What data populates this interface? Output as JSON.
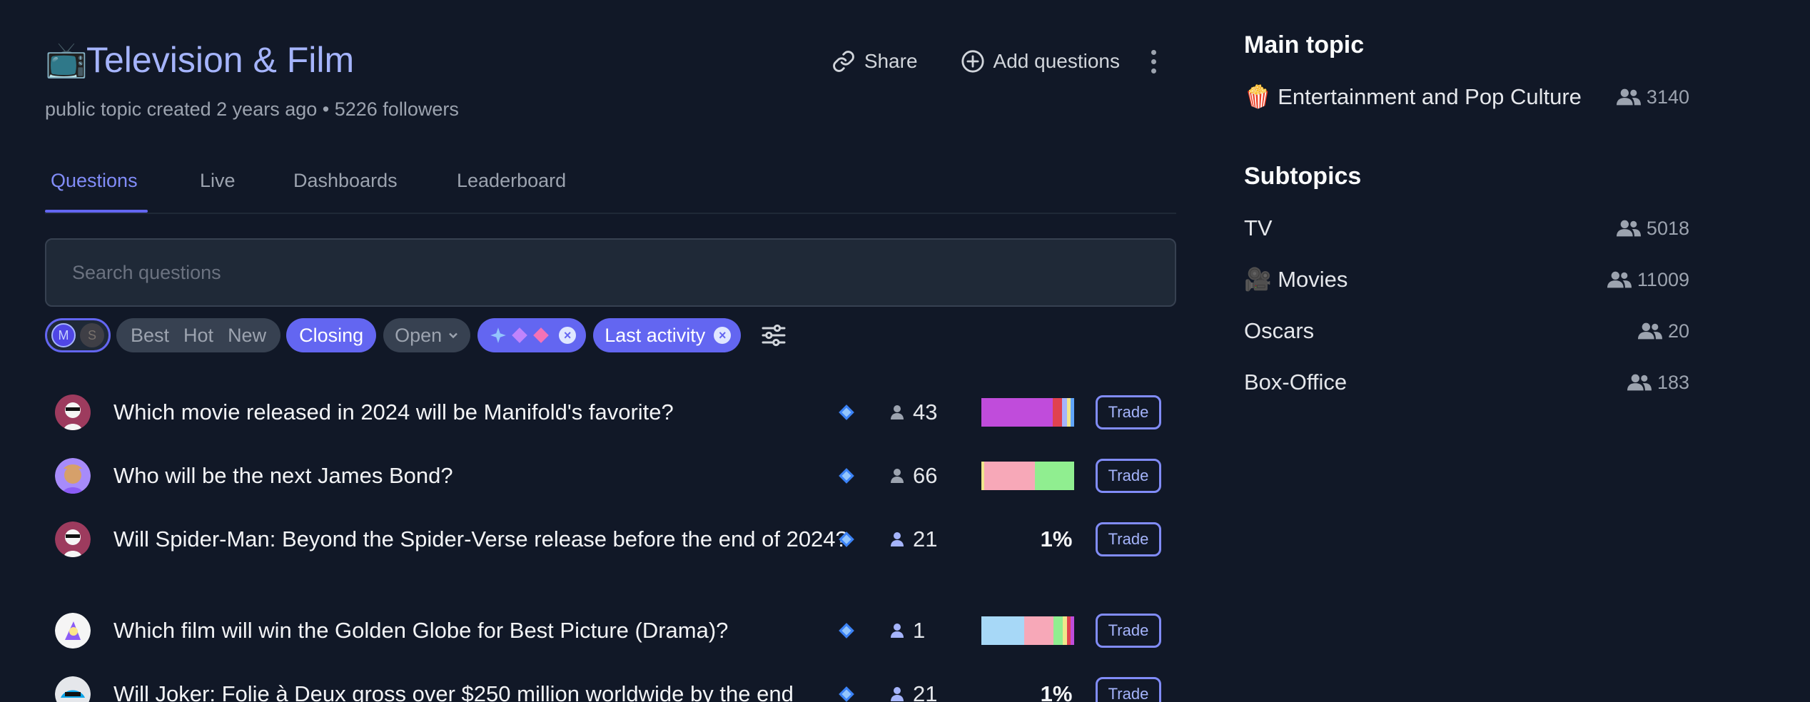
{
  "topic": {
    "emoji": "📺",
    "title": "Television & Film",
    "meta_prefix": "public topic created",
    "created": "2 years ago",
    "separator": "•",
    "followers": "5226 followers"
  },
  "header_actions": {
    "share_label": "Share",
    "add_label": "Add questions"
  },
  "tabs": [
    {
      "label": "Questions",
      "active": true
    },
    {
      "label": "Live"
    },
    {
      "label": "Dashboards"
    },
    {
      "label": "Leaderboard"
    }
  ],
  "search": {
    "placeholder": "Search questions"
  },
  "filters": {
    "sort_options": [
      "Best",
      "Hot",
      "New"
    ],
    "closing_label": "Closing",
    "status_label": "Open",
    "last_activity_label": "Last activity",
    "avatar_m_letter": "M",
    "avatar_s_letter": "S"
  },
  "questions": [
    {
      "title": "Which movie released in 2024 will be Manifold's favorite?",
      "traders": "43",
      "bar": [
        {
          "color": "#c04cdb",
          "fraction": 0.77
        },
        {
          "color": "#e0424f",
          "fraction": 0.1
        },
        {
          "color": "#a5b4fc",
          "fraction": 0.05
        },
        {
          "color": "#f0e68c",
          "fraction": 0.04
        },
        {
          "color": "#60a5fa",
          "fraction": 0.04
        }
      ],
      "trade_label": "Trade"
    },
    {
      "title": "Who will be the next James Bond?",
      "traders": "66",
      "bar": [
        {
          "color": "#f0e68c",
          "fraction": 0.03
        },
        {
          "color": "#f7a8b8",
          "fraction": 0.55
        },
        {
          "color": "#90ee90",
          "fraction": 0.42
        }
      ],
      "trade_label": "Trade"
    },
    {
      "title": "Will Spider-Man: Beyond the Spider-Verse release before the end of 2024?",
      "traders": "21",
      "probability": "1%",
      "trade_label": "Trade"
    },
    {
      "title": "Which film will win the Golden Globe for Best Picture (Drama)?",
      "traders": "1",
      "bar": [
        {
          "color": "#a7d8f7",
          "fraction": 0.46
        },
        {
          "color": "#f7a8b8",
          "fraction": 0.32
        },
        {
          "color": "#90ee90",
          "fraction": 0.1
        },
        {
          "color": "#f0e68c",
          "fraction": 0.04
        },
        {
          "color": "#e0424f",
          "fraction": 0.04
        },
        {
          "color": "#c04cdb",
          "fraction": 0.04
        }
      ],
      "trade_label": "Trade"
    },
    {
      "title": "Will Joker: Folie à Deux gross over $250 million worldwide by the end",
      "traders": "21",
      "probability": "1%",
      "trade_label": "Trade"
    }
  ],
  "sidebar": {
    "main_heading": "Main topic",
    "main_topic": {
      "emoji": "🍿",
      "name": "Entertainment and Pop Culture",
      "count": "3140"
    },
    "sub_heading": "Subtopics",
    "subtopics": [
      {
        "name": "TV",
        "count": "5018"
      },
      {
        "emoji": "🎥",
        "name": "Movies",
        "count": "11009"
      },
      {
        "name": "Oscars",
        "count": "20"
      },
      {
        "name": "Box-Office",
        "count": "183"
      }
    ]
  },
  "colors": {
    "accent": "#6366f1",
    "accent_light": "#a5b4fc",
    "background": "#111827"
  }
}
